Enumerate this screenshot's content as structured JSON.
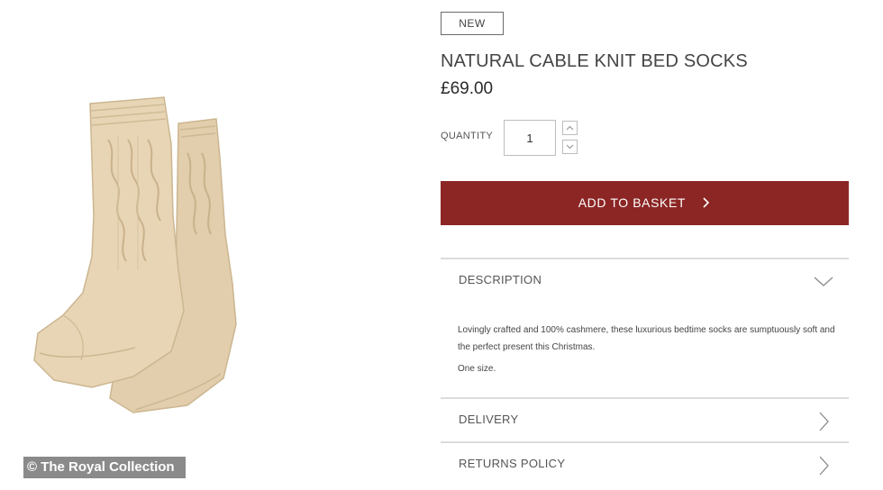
{
  "image": {
    "credit": "© The Royal Collection"
  },
  "product": {
    "badge": "NEW",
    "title": "NATURAL CABLE KNIT BED SOCKS",
    "price": "£69.00",
    "quantity_label": "QUANTITY",
    "quantity_value": "1",
    "add_to_basket_label": "ADD TO BASKET"
  },
  "accordion": {
    "description": {
      "heading": "DESCRIPTION",
      "text": "Lovingly crafted and 100% cashmere, these luxurious bedtime socks are sumptuously soft and the perfect present this Christmas.",
      "size": "One size."
    },
    "delivery": {
      "heading": "DELIVERY"
    },
    "returns": {
      "heading": "RETURNS POLICY"
    }
  },
  "icons": {
    "stepper_up": "chevron-up-icon",
    "stepper_down": "chevron-down-icon",
    "add_to_basket": "chevron-right-icon",
    "description_toggle": "chevron-down-icon",
    "delivery_toggle": "chevron-right-icon",
    "returns_toggle": "chevron-right-icon"
  },
  "colors": {
    "button": "#8b2625",
    "sock": "#e6d2b2"
  }
}
